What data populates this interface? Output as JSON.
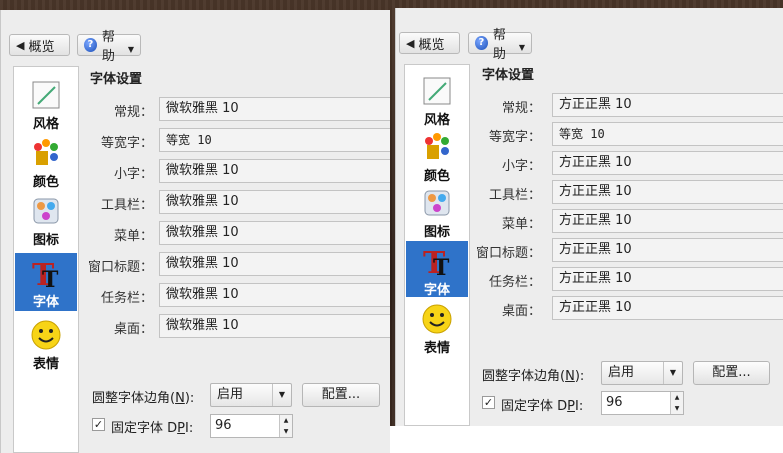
{
  "toolbar": {
    "overview_label": "概览",
    "help_label": "帮助"
  },
  "sidebar": {
    "items": [
      {
        "label": "风格",
        "icon": "brush-icon"
      },
      {
        "label": "颜色",
        "icon": "palette-icon"
      },
      {
        "label": "图标",
        "icon": "icons-icon"
      },
      {
        "label": "字体",
        "icon": "font-icon"
      },
      {
        "label": "表情",
        "icon": "smiley-icon"
      }
    ],
    "selected": "字体"
  },
  "font_settings": {
    "title": "字体设置",
    "labels": [
      "常规：",
      "等宽字：",
      "小字：",
      "工具栏：",
      "菜单：",
      "窗口标题：",
      "任务栏：",
      "桌面："
    ]
  },
  "left_panel": {
    "values": [
      "微软雅黑 10",
      "等宽 10",
      "微软雅黑 10",
      "微软雅黑 10",
      "微软雅黑 10",
      "微软雅黑 10",
      "微软雅黑 10",
      "微软雅黑 10"
    ]
  },
  "right_panel": {
    "values": [
      "方正正黑 10",
      "等宽 10",
      "方正正黑 10",
      "方正正黑 10",
      "方正正黑 10",
      "方正正黑 10",
      "方正正黑 10",
      "方正正黑 10"
    ]
  },
  "antialias": {
    "label_prefix": "圆整字体边角(",
    "label_key": "N",
    "label_suffix": "):",
    "value": "启用",
    "configure_label": "配置..."
  },
  "dpi": {
    "checked": true,
    "label_prefix": "固定字体 D",
    "label_key": "P",
    "label_suffix": "I:",
    "value": "96"
  },
  "colors": {
    "selected_bg": "#2f73c9",
    "panel_bg": "#ededed"
  }
}
